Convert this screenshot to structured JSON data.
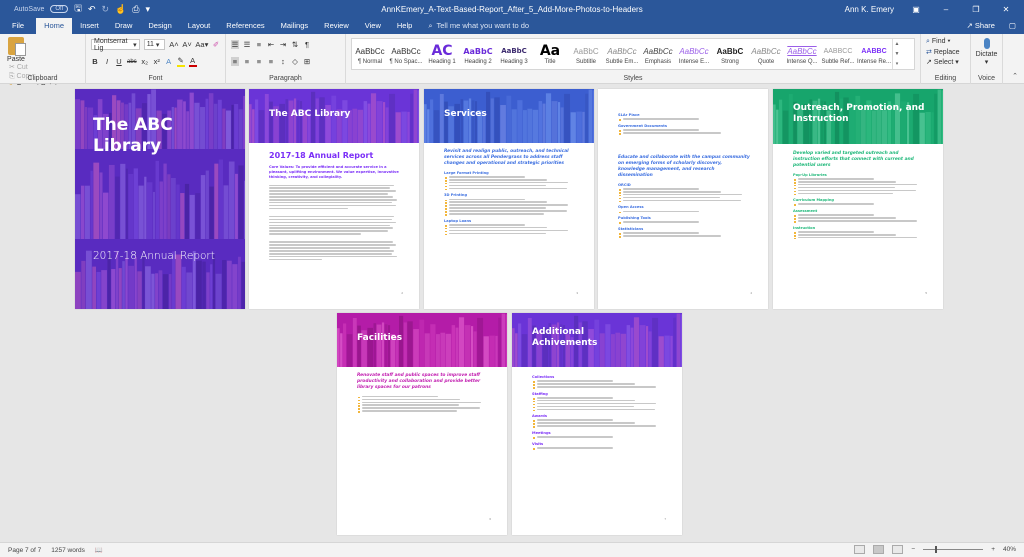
{
  "titlebar": {
    "autosave_label": "AutoSave",
    "autosave_state": "Off",
    "document_title": "AnnKEmery_A-Text-Based-Report_After_5_Add-More-Photos-to-Headers",
    "user_name": "Ann K. Emery"
  },
  "tabs": [
    "File",
    "Home",
    "Insert",
    "Draw",
    "Design",
    "Layout",
    "References",
    "Mailings",
    "Review",
    "View",
    "Help"
  ],
  "active_tab": "Home",
  "tell_me_placeholder": "Tell me what you want to do",
  "share_label": "Share",
  "clipboard": {
    "paste": "Paste",
    "cut": "Cut",
    "copy": "Copy",
    "format_painter": "Format Painter",
    "group_label": "Clipboard"
  },
  "font": {
    "font_name": "Montserrat Lig",
    "font_size": "11",
    "group_label": "Font",
    "buttons": [
      "B",
      "I",
      "U",
      "abc",
      "x₂",
      "x²"
    ]
  },
  "paragraph": {
    "group_label": "Paragraph"
  },
  "styles": {
    "group_label": "Styles",
    "items": [
      {
        "sample": "AaBbCc",
        "name": "¶ Normal"
      },
      {
        "sample": "AaBbCc",
        "name": "¶ No Spac..."
      },
      {
        "sample": "AC",
        "name": "Heading 1"
      },
      {
        "sample": "AaBbC",
        "name": "Heading 2"
      },
      {
        "sample": "AaBbC",
        "name": "Heading 3"
      },
      {
        "sample": "Aa",
        "name": "Title"
      },
      {
        "sample": "AaBbC",
        "name": "Subtitle"
      },
      {
        "sample": "AaBbCc",
        "name": "Subtle Em..."
      },
      {
        "sample": "AaBbCc",
        "name": "Emphasis"
      },
      {
        "sample": "AaBbCc",
        "name": "Intense E..."
      },
      {
        "sample": "AaBbC",
        "name": "Strong"
      },
      {
        "sample": "AaBbCc",
        "name": "Quote"
      },
      {
        "sample": "AaBbCc",
        "name": "Intense Q..."
      },
      {
        "sample": "AABBCC",
        "name": "Subtle Ref..."
      },
      {
        "sample": "AABBC",
        "name": "Intense Re..."
      }
    ]
  },
  "editing": {
    "find": "Find",
    "replace": "Replace",
    "select": "Select",
    "group_label": "Editing"
  },
  "voice": {
    "dictate": "Dictate",
    "group_label": "Voice"
  },
  "pages": {
    "cover": {
      "title": "The ABC Library",
      "subtitle": "2017-18 Annual Report"
    },
    "p2": {
      "header": "The ABC Library",
      "heading": "2017-18 Annual Report",
      "core_values": "Core Values: To provide efficient and accurate service in a pleasant, uplifting environment. We value expertise, innovative thinking, creativity, and collegiality.",
      "page_number": "2"
    },
    "p3": {
      "header": "Services",
      "goal": "Revisit and realign public, outreach, and technical services across all Pendergrass to address staff changes and operational and strategic priorities",
      "sections": [
        "Large Format Printing",
        "3D Printing",
        "Laptop Loans"
      ],
      "page_number": "3"
    },
    "p4": {
      "sections_top": [
        "SLAr Place",
        "Government Documents"
      ],
      "goal": "Educate and collaborate with the campus community on emerging forms of scholarly discovery, knowledge management, and research dissemination",
      "sections": [
        "ORCID",
        "Open Access",
        "Publishing Tools",
        "Statisticians"
      ],
      "page_number": "4"
    },
    "p5": {
      "header": "Outreach, Promotion, and Instruction",
      "goal": "Develop varied and targeted outreach and instruction efforts that connect with current and potential users",
      "sections": [
        "Pop-Up Libraries",
        "Curriculum Mapping",
        "Assessment",
        "Instruction"
      ],
      "page_number": "5"
    },
    "p6": {
      "header": "Facilities",
      "goal": "Renovate staff and public spaces to improve staff productivity and collaboration and provide better library spaces for our patrons",
      "page_number": "6"
    },
    "p7": {
      "header": "Additional Achivements",
      "sections": [
        "Collections",
        "Staffing",
        "Awards",
        "Meetings",
        "Visits"
      ],
      "page_number": "7"
    }
  },
  "statusbar": {
    "page": "Page 7 of 7",
    "words": "1257 words",
    "zoom": "40%",
    "zoom_fraction": 0.4
  },
  "colors": {
    "word_blue": "#2b579a",
    "purple": "#7b2ff7",
    "blue": "#3c6fe0",
    "green": "#1fb87a",
    "magenta": "#c21fb0"
  }
}
